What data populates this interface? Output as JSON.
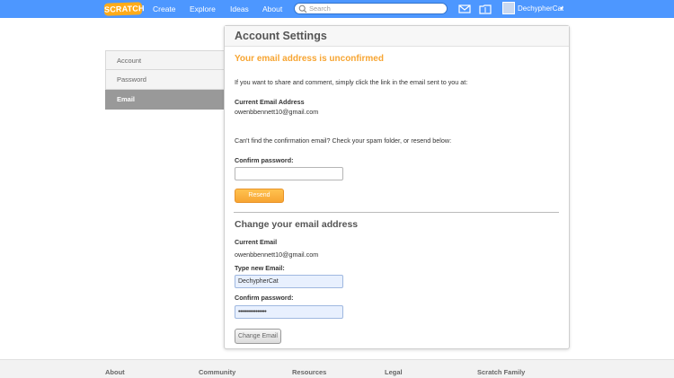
{
  "nav": {
    "logo": "SCRATCH",
    "links": [
      "Create",
      "Explore",
      "Ideas",
      "About"
    ],
    "search_placeholder": "Search",
    "username": "DechypherCat"
  },
  "sidebar": {
    "items": [
      {
        "label": "Account"
      },
      {
        "label": "Password"
      },
      {
        "label": "Email"
      }
    ]
  },
  "panel": {
    "title": "Account Settings",
    "unconfirmed_heading": "Your email address is unconfirmed",
    "share_text": "If you want to share and comment, simply click the link in the email sent to you at:",
    "current_label": "Current Email Address",
    "current_value": "owenbbennett10@gmail.com",
    "spam_text": "Can't find the confirmation email? Check your spam folder, or resend below:",
    "confirm_label": "Confirm password:",
    "resend_label": "Resend",
    "change_heading": "Change your email address",
    "current_email_label": "Current Email",
    "current_email_value": "owenbbennett10@gmail.com",
    "new_email_label": "Type new Email:",
    "new_email_value": "DechypherCat",
    "confirm2_label": "Confirm password:",
    "confirm2_value": "••••••••••••••••",
    "change_button": "Change Email"
  },
  "footer": {
    "headings": [
      "About",
      "Community",
      "Resources",
      "Legal",
      "Scratch Family"
    ]
  },
  "colors": {
    "nav_blue": "#4d97ff",
    "orange": "#f7a532",
    "sidebar_active": "#999999"
  }
}
